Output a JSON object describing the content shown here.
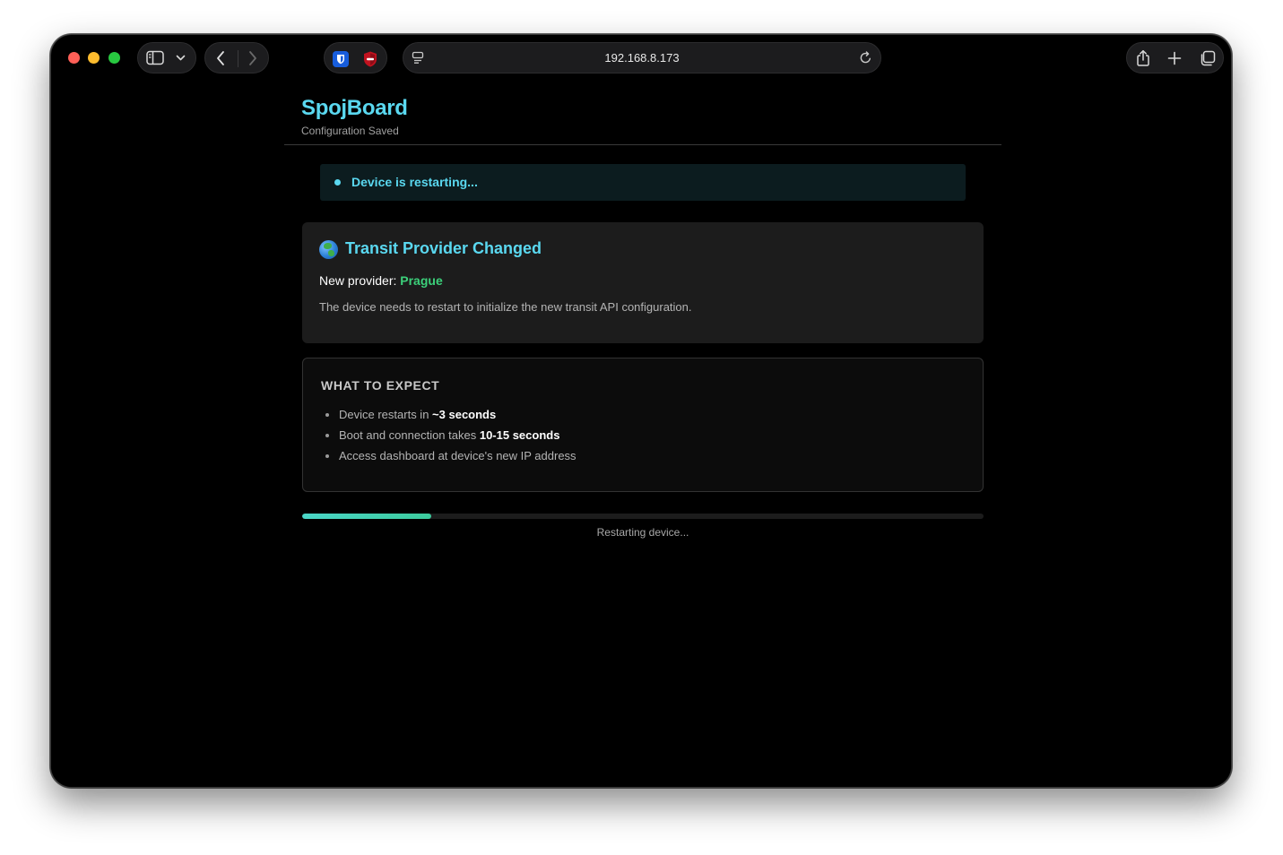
{
  "browser": {
    "address": "192.168.8.173",
    "icons": {
      "sidebar": "sidebar-icon",
      "sidebar_menu": "chevron-down-icon",
      "back": "chevron-left-icon",
      "forward": "chevron-right-icon",
      "extension_1": "password-manager-shield-icon",
      "extension_2": "ad-blocker-icon",
      "page_menu": "page-settings-icon",
      "reload": "reload-icon",
      "share": "share-icon",
      "new_tab": "plus-icon",
      "tabs": "tab-overview-icon"
    }
  },
  "header": {
    "brand": "SpojBoard",
    "subtitle": "Configuration Saved"
  },
  "status": {
    "text": "Device is restarting..."
  },
  "provider_card": {
    "icon": "globe-icon",
    "title": "Transit Provider Changed",
    "label": "New provider: ",
    "value": "Prague",
    "description": "The device needs to restart to initialize the new transit API configuration."
  },
  "expect": {
    "title": "WHAT TO EXPECT",
    "items": [
      {
        "text": "Device restarts in ",
        "bold": "~3 seconds"
      },
      {
        "text": "Boot and connection takes ",
        "bold": "10-15 seconds"
      },
      {
        "text": "Access dashboard at device's new IP address",
        "bold": ""
      }
    ]
  },
  "progress": {
    "percent": 19,
    "label": "Restarting device..."
  },
  "colors": {
    "accent": "#5ad8f0",
    "success": "#3cd07a",
    "progress": "#3ccb9d"
  }
}
